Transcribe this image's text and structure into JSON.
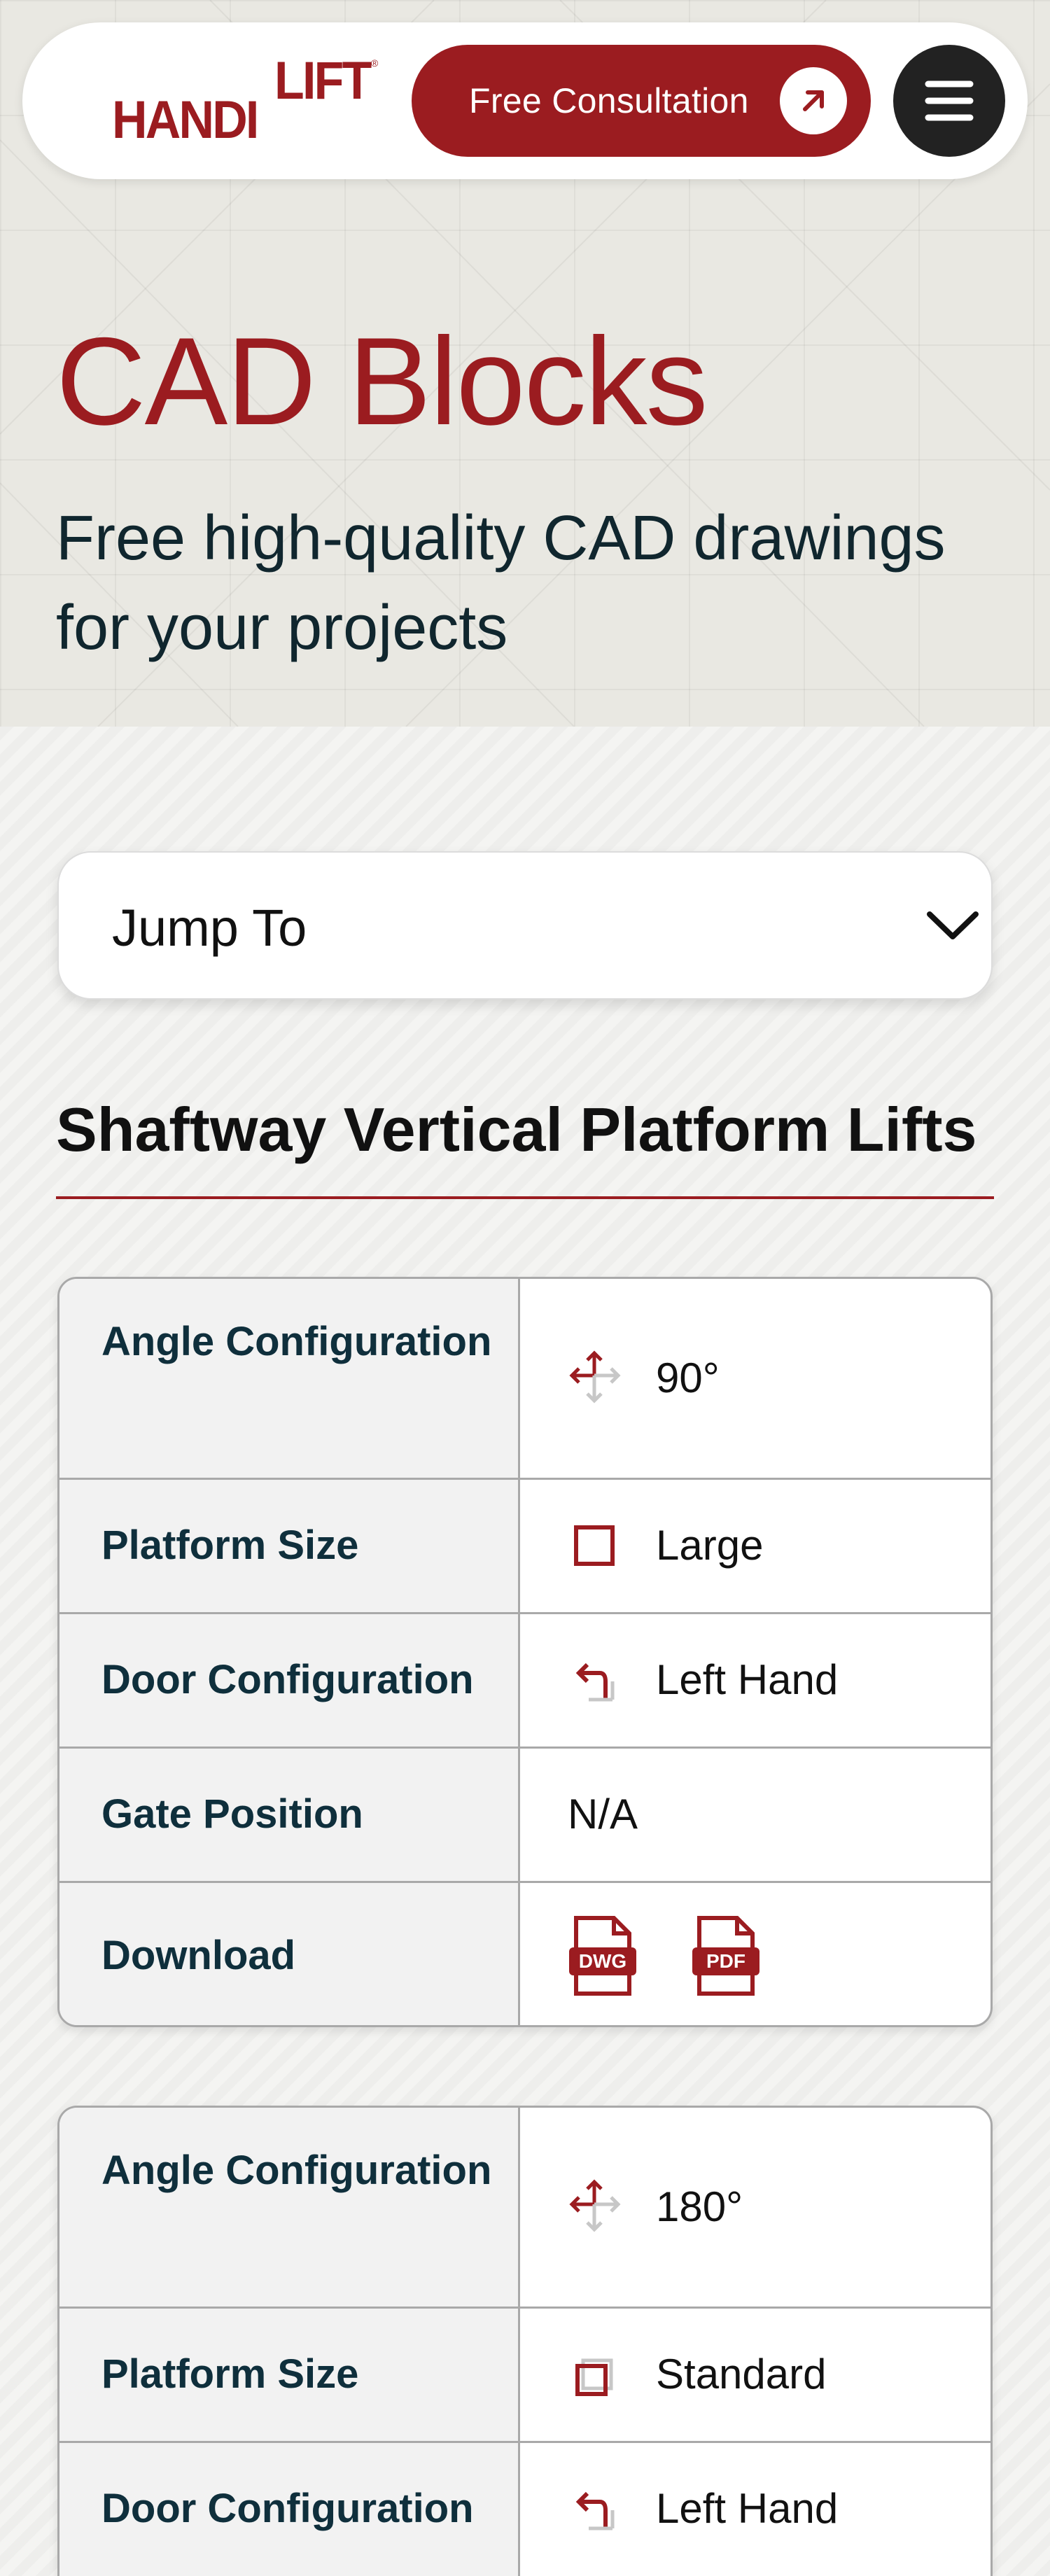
{
  "header": {
    "logo": {
      "text_a": "HANDI",
      "text_b": "LIFT",
      "reg": "®"
    },
    "cta_label": "Free Consultation",
    "cta_icon": "arrow-up-right-icon",
    "menu_icon": "hamburger-menu-icon"
  },
  "hero": {
    "title": "CAD Blocks",
    "subtitle": "Free high-quality CAD drawings for your projects"
  },
  "jump_to": {
    "label": "Jump To",
    "icon": "chevron-down-icon"
  },
  "section": {
    "title": "Shaftway Vertical Platform Lifts"
  },
  "colors": {
    "brand": "#9b1c20",
    "text_dark": "#0f2f3c",
    "border": "#a9a9a9",
    "menu_bg": "#222222"
  },
  "tables": [
    {
      "rows": [
        {
          "key": "Angle Configuration",
          "value": "90°",
          "icon": "angle-arrows-icon"
        },
        {
          "key": "Platform Size",
          "value": "Large",
          "icon": "square-large-icon"
        },
        {
          "key": "Door Configuration",
          "value": "Left Hand",
          "icon": "door-left-hand-icon"
        },
        {
          "key": "Gate Position",
          "value": "N/A",
          "icon": ""
        },
        {
          "key": "Download",
          "downloads": [
            "DWG",
            "PDF"
          ],
          "icon": "file-download-icon"
        }
      ]
    },
    {
      "rows": [
        {
          "key": "Angle Configuration",
          "value": "180°",
          "icon": "angle-arrows-icon"
        },
        {
          "key": "Platform Size",
          "value": "Standard",
          "icon": "square-standard-icon"
        },
        {
          "key": "Door Configuration",
          "value": "Left Hand",
          "icon": "door-left-hand-icon"
        }
      ]
    }
  ]
}
